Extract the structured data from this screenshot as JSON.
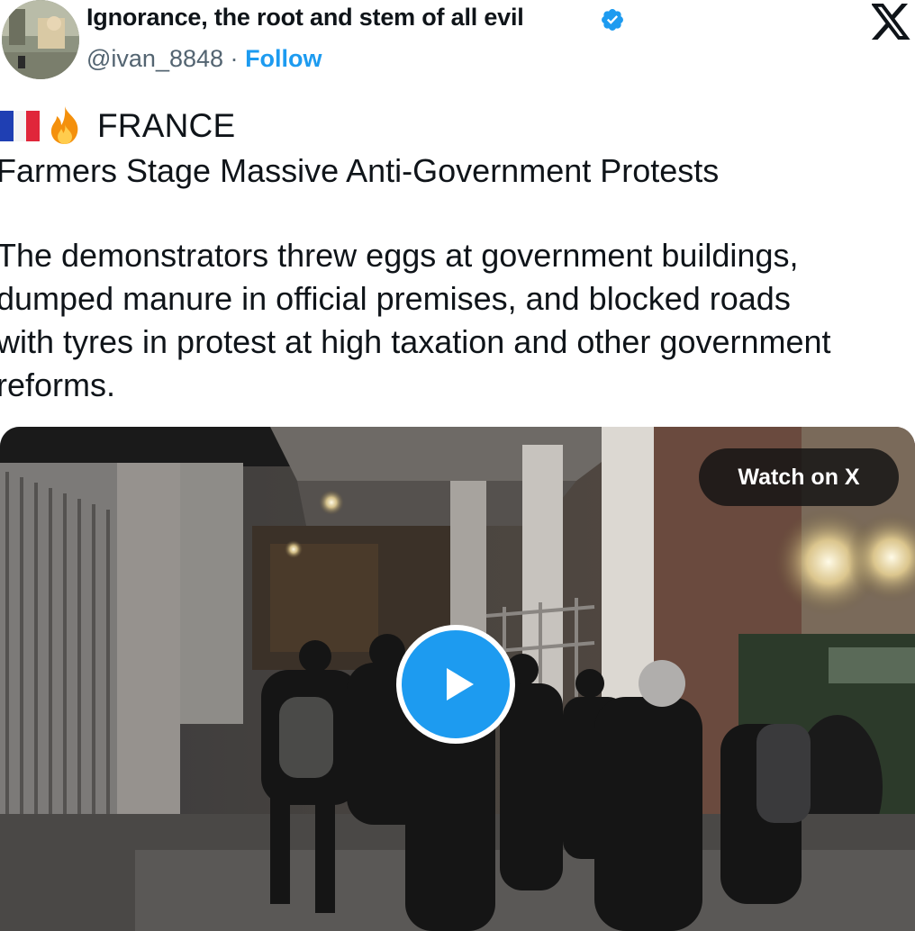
{
  "author": {
    "display_name": "Ignorance, the root and stem of all evil",
    "handle": "@ivan_8848",
    "separator": "·",
    "follow_label": "Follow",
    "verified": true
  },
  "brand": {
    "logo_icon": "x-logo-icon"
  },
  "tweet": {
    "flag_icon": "france-flag-icon",
    "fire_icon": "fire-icon",
    "country": "FRANCE",
    "headline": "Farmers Stage Massive Anti-Government Protests",
    "body_lines": [
      "The demonstrators threw eggs at government buildings,",
      "dumped manure in official premises, and blocked roads",
      "with tyres in protest at high taxation and other government",
      "reforms."
    ]
  },
  "media": {
    "watch_label": "Watch on X",
    "play_icon": "play-icon"
  },
  "colors": {
    "accent": "#1d9bf0",
    "text": "#0f1419",
    "secondary_text": "#536471"
  }
}
